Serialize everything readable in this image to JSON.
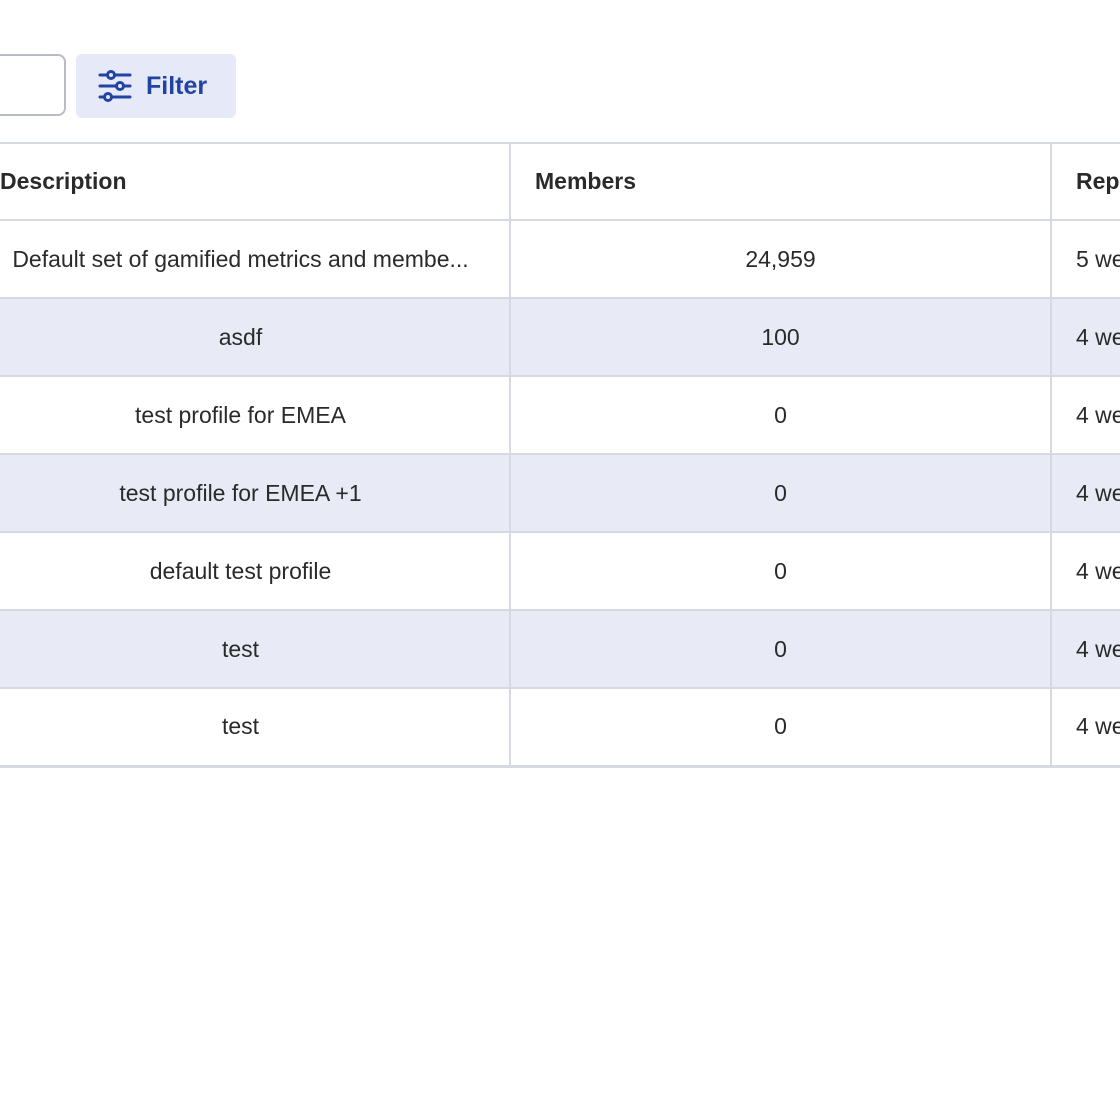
{
  "toolbar": {
    "filter_label": "Filter"
  },
  "table": {
    "columns": [
      "Description",
      "Members",
      "Rep"
    ],
    "rows": [
      {
        "description": "Default set of gamified metrics and membe...",
        "members": "24,959",
        "rep": "5 we"
      },
      {
        "description": "asdf",
        "members": "100",
        "rep": "4 we"
      },
      {
        "description": "test profile for EMEA",
        "members": "0",
        "rep": "4 we"
      },
      {
        "description": "test profile for EMEA +1",
        "members": "0",
        "rep": "4 we"
      },
      {
        "description": "default test profile",
        "members": "0",
        "rep": "4 we"
      },
      {
        "description": "test",
        "members": "0",
        "rep": "4 we"
      },
      {
        "description": "test",
        "members": "0",
        "rep": "4 we"
      }
    ]
  },
  "icons": {
    "filter": "sliders-icon"
  },
  "colors": {
    "accent": "#2143a1",
    "button_bg": "#e6e9f7",
    "row_alt": "#e8ebf5"
  }
}
